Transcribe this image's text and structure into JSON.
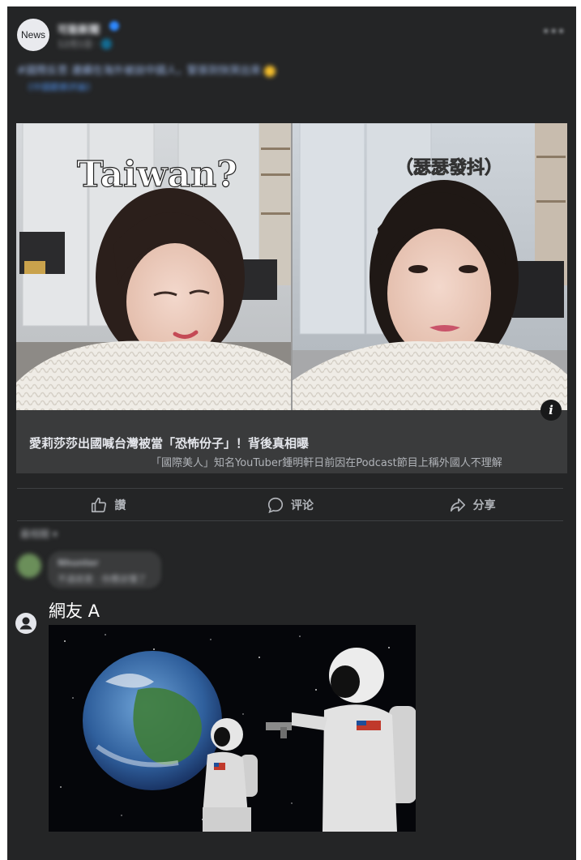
{
  "page": {
    "avatar_text": "News",
    "name": "可能新聞",
    "meta": "12月1日 · 🌐",
    "more": "•••",
    "post_text": "#國際反思 連續在海外被說中國人，緊張到快哭出來",
    "post_subtext": "《中國觀察評論》"
  },
  "link_card": {
    "image_text_left": "Taiwan?",
    "image_text_right": "（瑟瑟發抖）",
    "info_icon": "i",
    "title": "愛莉莎莎出國喊台灣被當「恐怖份子」！背後真相曝",
    "description": "「國際美人」知名YouTuber鍾明軒日前因在Podcast節目上稱外國人不理解"
  },
  "actions": {
    "like_label": "讚",
    "comment_label": "评论",
    "share_label": "分享"
  },
  "comments": {
    "sort_label": "最相關 ▾",
    "blurred_name": "Nhunter",
    "blurred_text": "不過就是 · 你應該懂了",
    "commenter_name": "網友 A"
  },
  "colors": {
    "panel": "#242526",
    "card": "#3a3b3c",
    "text": "#e4e6eb",
    "muted": "#b0b3b8",
    "accent": "#2d88ff"
  }
}
